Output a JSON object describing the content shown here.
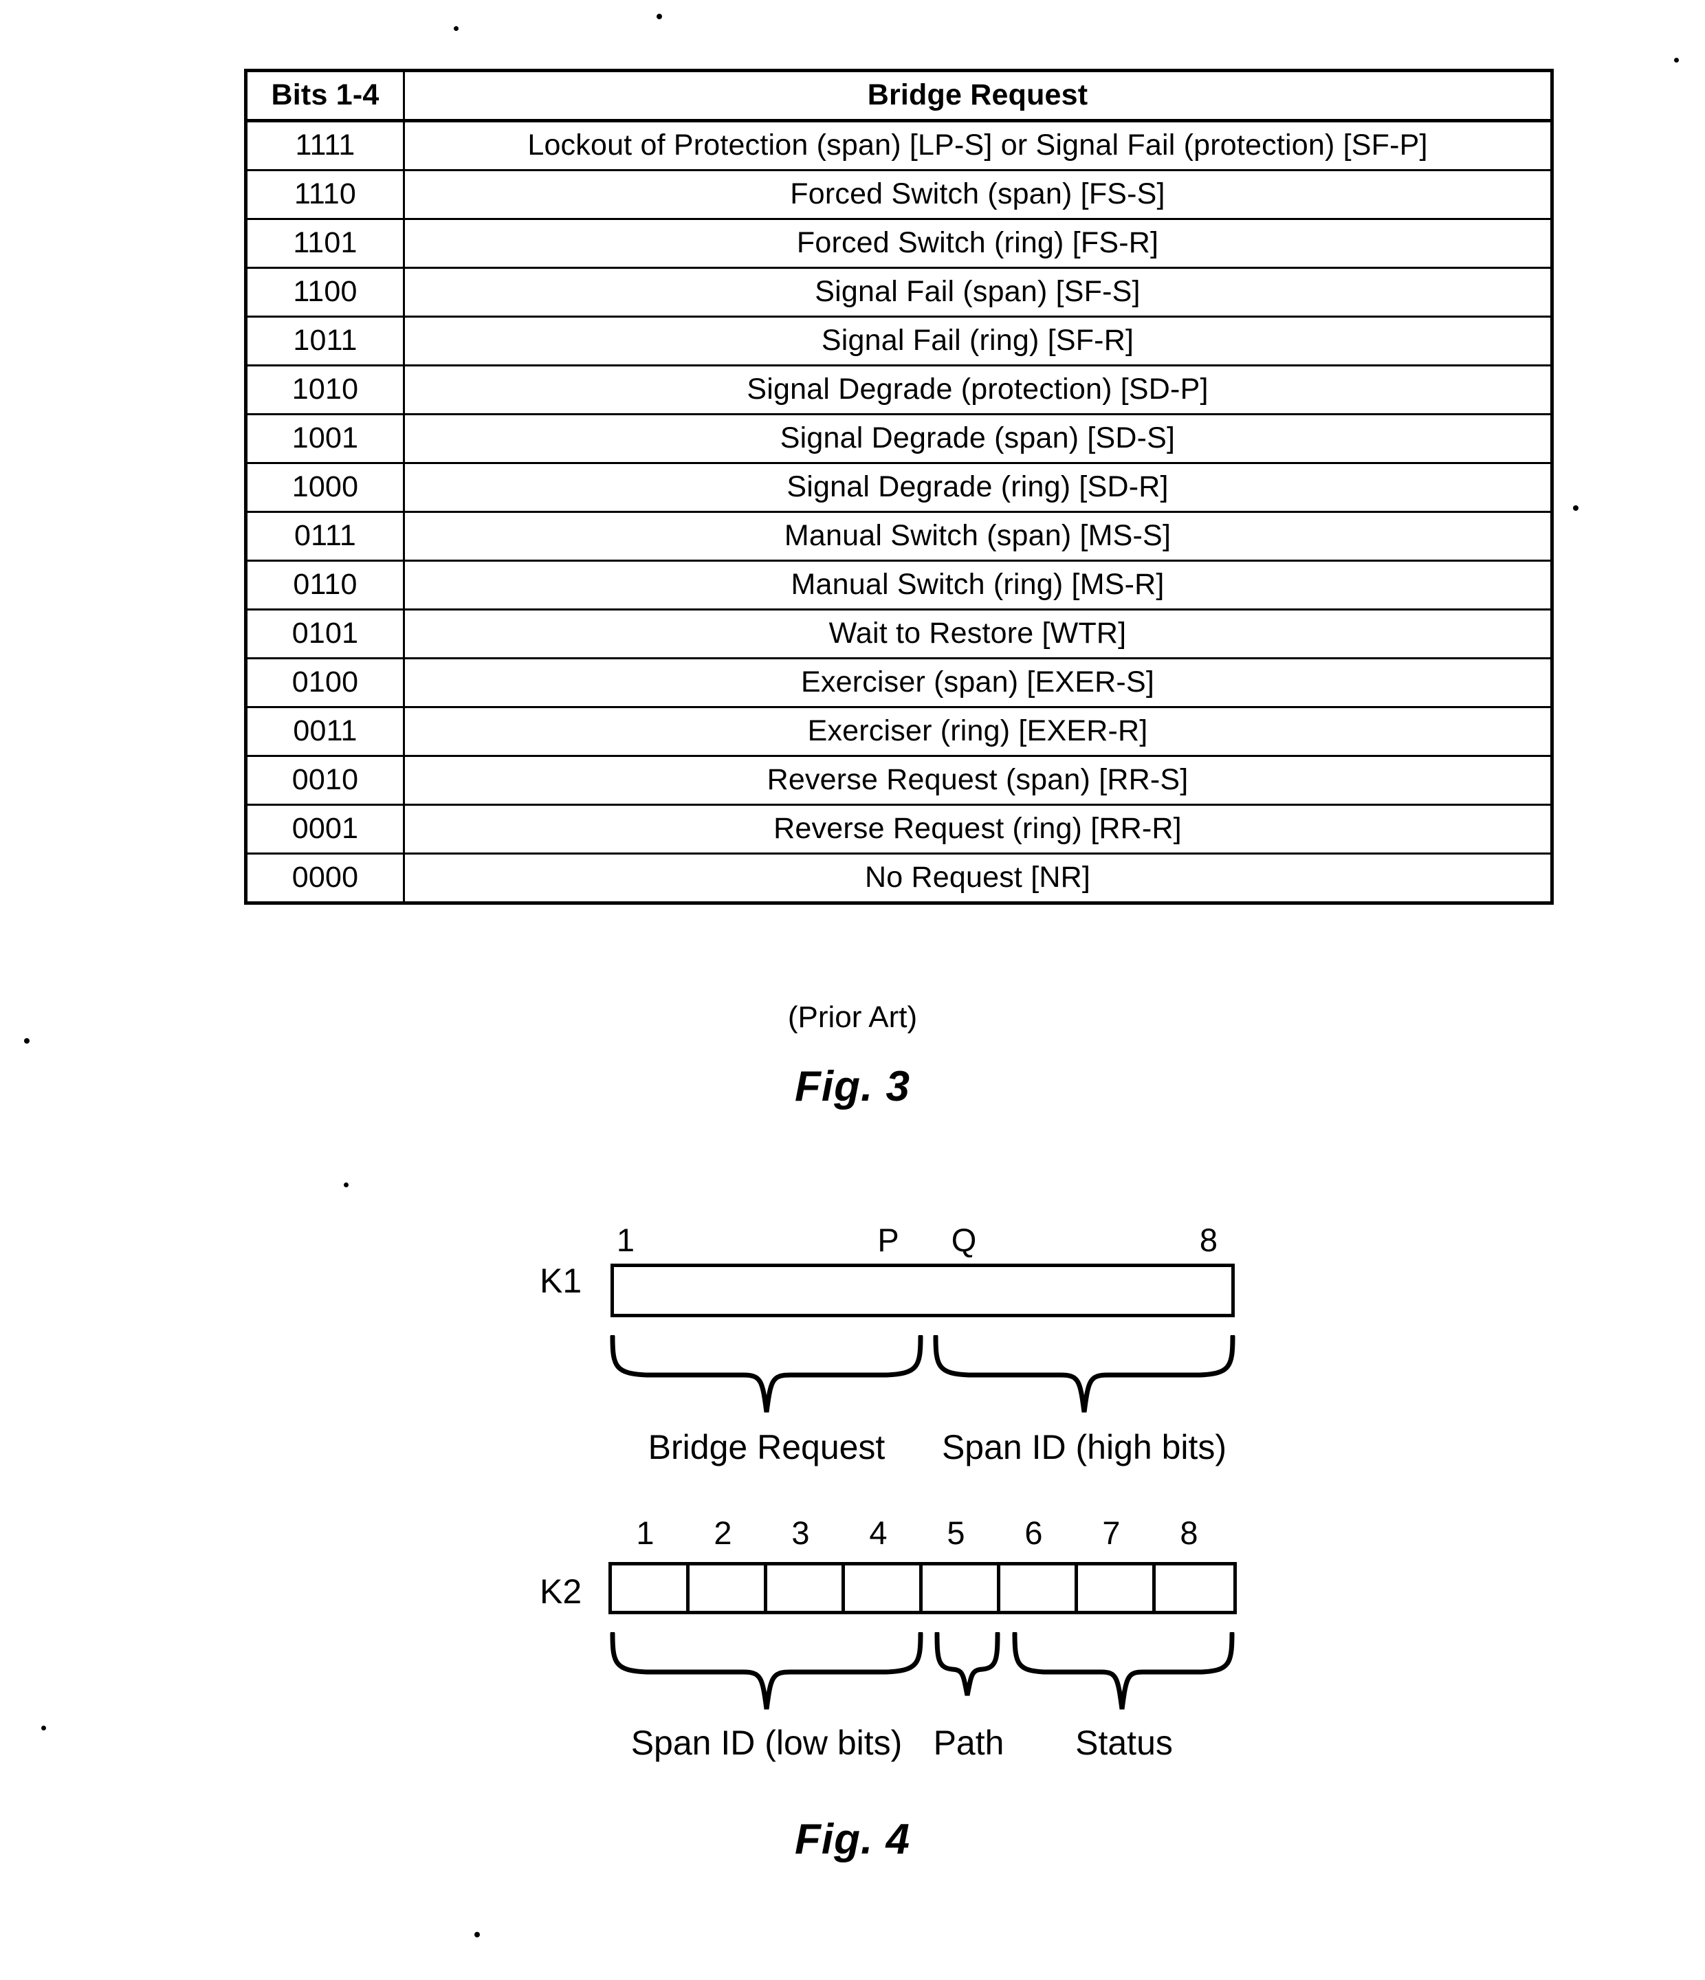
{
  "figure3": {
    "caption": "Fig. 3",
    "note": "(Prior Art)",
    "table": {
      "headers": [
        "Bits 1-4",
        "Bridge Request"
      ],
      "rows": [
        [
          "1111",
          "Lockout of Protection (span) [LP-S] or Signal Fail (protection) [SF-P]"
        ],
        [
          "1110",
          "Forced Switch (span) [FS-S]"
        ],
        [
          "1101",
          "Forced Switch (ring) [FS-R]"
        ],
        [
          "1100",
          "Signal Fail (span) [SF-S]"
        ],
        [
          "1011",
          "Signal Fail (ring) [SF-R]"
        ],
        [
          "1010",
          "Signal Degrade (protection) [SD-P]"
        ],
        [
          "1001",
          "Signal Degrade (span) [SD-S]"
        ],
        [
          "1000",
          "Signal Degrade (ring) [SD-R]"
        ],
        [
          "0111",
          "Manual Switch (span) [MS-S]"
        ],
        [
          "0110",
          "Manual Switch (ring) [MS-R]"
        ],
        [
          "0101",
          "Wait to Restore [WTR]"
        ],
        [
          "0100",
          "Exerciser (span) [EXER-S]"
        ],
        [
          "0011",
          "Exerciser (ring) [EXER-R]"
        ],
        [
          "0010",
          "Reverse Request (span) [RR-S]"
        ],
        [
          "0001",
          "Reverse Request (ring) [RR-R]"
        ],
        [
          "0000",
          "No Request [NR]"
        ]
      ]
    }
  },
  "figure4": {
    "caption": "Fig. 4",
    "k1": {
      "label": "K1",
      "ticks": [
        "1",
        "P",
        "Q",
        "8"
      ],
      "fields": [
        "Bridge Request",
        "Span ID (high bits)"
      ]
    },
    "k2": {
      "label": "K2",
      "ticks": [
        "1",
        "2",
        "3",
        "4",
        "5",
        "6",
        "7",
        "8"
      ],
      "fields": [
        "Span ID (low bits)",
        "Path",
        "Status"
      ]
    }
  },
  "colors": {
    "ink": "#000000",
    "paper": "#ffffff"
  }
}
